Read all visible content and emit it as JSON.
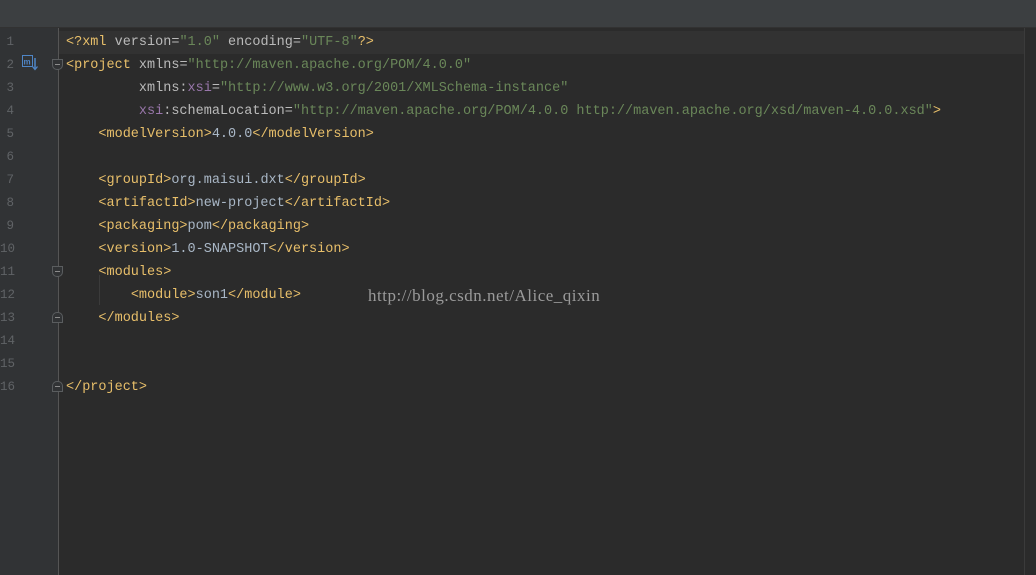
{
  "editor": {
    "line_numbers": [
      "1",
      "2",
      "3",
      "4",
      "5",
      "6",
      "7",
      "8",
      "9",
      "10",
      "11",
      "12",
      "13",
      "14",
      "15",
      "16"
    ],
    "lines": {
      "l1": {
        "open": "<?xml ",
        "attr1": "version",
        "eq1": "=",
        "val1": "\"1.0\"",
        "attr2": " encoding",
        "eq2": "=",
        "val2": "\"UTF-8\"",
        "close": "?>"
      },
      "l2": {
        "open": "<project ",
        "attr": "xmlns",
        "eq": "=",
        "val": "\"http://maven.apache.org/POM/4.0.0\""
      },
      "l3": {
        "indent": "         ",
        "attr": "xmlns:",
        "ns": "xsi",
        "eq": "=",
        "val": "\"http://www.w3.org/2001/XMLSchema-instance\""
      },
      "l4": {
        "indent": "         ",
        "ns": "xsi",
        "attr": ":schemaLocation",
        "eq": "=",
        "val": "\"http://maven.apache.org/POM/4.0.0 http://maven.apache.org/xsd/maven-4.0.0.xsd\"",
        "close": ">"
      },
      "l5": {
        "indent": "    ",
        "open": "<modelVersion>",
        "text": "4.0.0",
        "close": "</modelVersion>"
      },
      "l7": {
        "indent": "    ",
        "open": "<groupId>",
        "text": "org.maisui.dxt",
        "close": "</groupId>"
      },
      "l8": {
        "indent": "    ",
        "open": "<artifactId>",
        "text": "new-project",
        "close": "</artifactId>"
      },
      "l9": {
        "indent": "    ",
        "open": "<packaging>",
        "text": "pom",
        "close": "</packaging>"
      },
      "l10": {
        "indent": "    ",
        "open": "<version>",
        "text": "1.0-SNAPSHOT",
        "close": "</version>"
      },
      "l11": {
        "indent": "    ",
        "open": "<modules>"
      },
      "l12": {
        "indent": "        ",
        "open": "<module>",
        "text": "son1",
        "close": "</module>"
      },
      "l13": {
        "indent": "    ",
        "close": "</modules>"
      },
      "l16": {
        "close": "</project>"
      }
    }
  },
  "gutter": {
    "maven_icon": "maven-icon"
  },
  "watermark": "http://blog.csdn.net/Alice_qixin",
  "colors": {
    "background": "#2b2b2b",
    "gutter": "#313335",
    "tag": "#e8bf6a",
    "attribute": "#bababa",
    "value": "#6a8759",
    "namespace": "#9876aa",
    "text": "#a9b7c6",
    "line_number": "#606366"
  }
}
